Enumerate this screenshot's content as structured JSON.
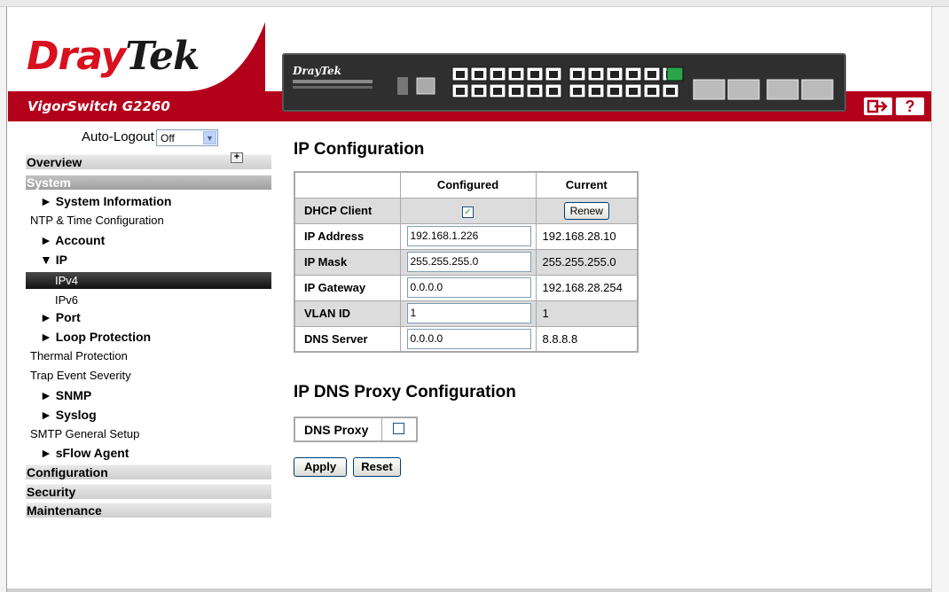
{
  "header": {
    "brand_left": "Dray",
    "brand_right": "Tek",
    "model": "VigorSwitch G2260",
    "device_brand": "DrayTek",
    "logout_icon": "logout-arrow-icon",
    "help_label": "?"
  },
  "sidebar": {
    "autologout_label": "Auto-Logout",
    "autologout_value": "Off",
    "sections": {
      "overview": "Overview",
      "system": "System",
      "configuration": "Configuration",
      "security": "Security",
      "maintenance": "Maintenance"
    },
    "items": {
      "system_information": "► System Information",
      "ntp": "NTP & Time Configuration",
      "account": "► Account",
      "ip": "▼ IP",
      "ipv4": "IPv4",
      "ipv6": "IPv6",
      "port": "► Port",
      "loop_protection": "► Loop Protection",
      "thermal": "Thermal Protection",
      "trap": "Trap Event Severity",
      "snmp": "► SNMP",
      "syslog": "► Syslog",
      "smtp": "SMTP General Setup",
      "sflow": "► sFlow Agent"
    }
  },
  "main": {
    "title": "IP Configuration",
    "columns": {
      "configured": "Configured",
      "current": "Current"
    },
    "rows": {
      "dhcp": {
        "label": "DHCP Client",
        "renew": "Renew",
        "checked": "✓"
      },
      "ip": {
        "label": "IP Address",
        "configured": "192.168.1.226",
        "current": "192.168.28.10"
      },
      "mask": {
        "label": "IP Mask",
        "configured": "255.255.255.0",
        "current": "255.255.255.0"
      },
      "gateway": {
        "label": "IP Gateway",
        "configured": "0.0.0.0",
        "current": "192.168.28.254"
      },
      "vlan": {
        "label": "VLAN ID",
        "configured": "1",
        "current": "1"
      },
      "dns": {
        "label": "DNS Server",
        "configured": "0.0.0.0",
        "current": "8.8.8.8"
      }
    },
    "dns_proxy_title": "IP DNS Proxy Configuration",
    "dns_proxy_label": "DNS Proxy",
    "apply": "Apply",
    "reset": "Reset"
  }
}
